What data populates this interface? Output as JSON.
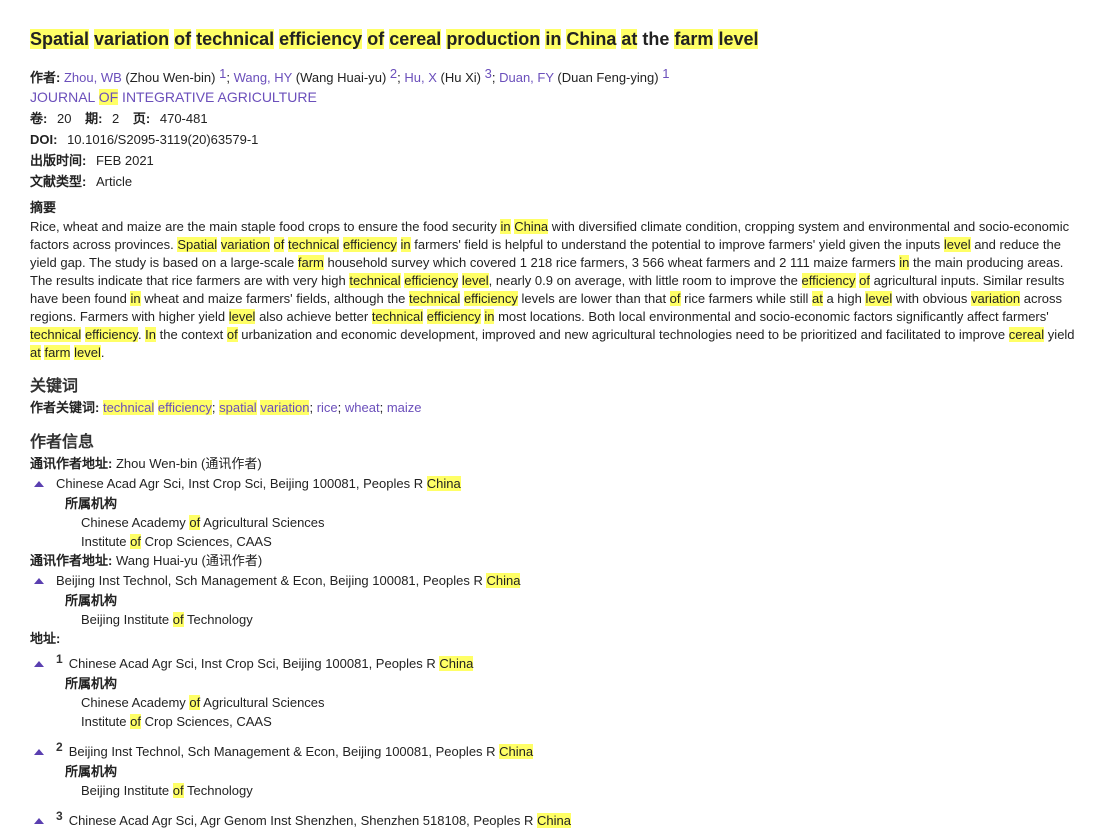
{
  "title": [
    "Spatial",
    "variation",
    "of",
    "technical",
    "efficiency",
    "of",
    "cereal",
    "production",
    "in",
    "China",
    "at",
    "the",
    "farm",
    "level"
  ],
  "title_highlight": [
    true,
    true,
    true,
    true,
    true,
    true,
    true,
    true,
    true,
    true,
    true,
    false,
    true,
    true
  ],
  "labels": {
    "authors": "作者:",
    "volume": "卷:",
    "issue": "期:",
    "pages": "页:",
    "doi": "DOI:",
    "pub_date": "出版时间:",
    "doc_type": "文献类型:",
    "abstract": "摘要",
    "keywords_heading": "关键词",
    "author_keywords": "作者关键词:",
    "author_info": "作者信息",
    "corr_addr": "通讯作者地址:",
    "affil": "所属机构",
    "address": "地址:"
  },
  "authors": [
    {
      "short": "Zhou, WB",
      "full": "(Zhou Wen-bin)",
      "sup": "1"
    },
    {
      "short": "Wang, HY",
      "full": "(Wang Huai-yu)",
      "sup": "2"
    },
    {
      "short": "Hu, X",
      "full": "(Hu Xi)",
      "sup": "3"
    },
    {
      "short": "Duan, FY",
      "full": "(Duan Feng-ying)",
      "sup": "1"
    }
  ],
  "journal": {
    "pre": "JOURNAL ",
    "hl": "OF",
    "post": " INTEGRATIVE AGRICULTURE"
  },
  "volume": "20",
  "issue": "2",
  "pages": "470-481",
  "doi": "10.1016/S2095-3119(20)63579-1",
  "pub_date": "FEB 2021",
  "doc_type": "Article",
  "abstract": [
    {
      "t": "Rice, wheat and maize are the main staple food crops to ensure the food security "
    },
    {
      "t": "in",
      "h": true
    },
    {
      "t": " "
    },
    {
      "t": "China",
      "h": true
    },
    {
      "t": " with diversified climate condition, cropping system and environmental and socio-economic factors across provinces. "
    },
    {
      "t": "Spatial",
      "h": true
    },
    {
      "t": " "
    },
    {
      "t": "variation",
      "h": true
    },
    {
      "t": " "
    },
    {
      "t": "of",
      "h": true
    },
    {
      "t": " "
    },
    {
      "t": "technical",
      "h": true
    },
    {
      "t": " "
    },
    {
      "t": "efficiency",
      "h": true
    },
    {
      "t": " "
    },
    {
      "t": "in",
      "h": true
    },
    {
      "t": " farmers' field is helpful to understand the potential to improve farmers' yield given the inputs "
    },
    {
      "t": "level",
      "h": true
    },
    {
      "t": " and reduce the yield gap. The study is based on a large-scale "
    },
    {
      "t": "farm",
      "h": true
    },
    {
      "t": " household survey which covered 1 218 rice farmers, 3 566 wheat farmers and 2 111 maize farmers "
    },
    {
      "t": "in",
      "h": true
    },
    {
      "t": " the main producing areas. The results indicate that rice farmers are with very high "
    },
    {
      "t": "technical",
      "h": true
    },
    {
      "t": " "
    },
    {
      "t": "efficiency",
      "h": true
    },
    {
      "t": " "
    },
    {
      "t": "level",
      "h": true
    },
    {
      "t": ", nearly 0.9 on average, with little room to improve the "
    },
    {
      "t": "efficiency",
      "h": true
    },
    {
      "t": " "
    },
    {
      "t": "of",
      "h": true
    },
    {
      "t": " agricultural inputs. Similar results have been found "
    },
    {
      "t": "in",
      "h": true
    },
    {
      "t": " wheat and maize farmers' fields, although the "
    },
    {
      "t": "technical",
      "h": true
    },
    {
      "t": " "
    },
    {
      "t": "efficiency",
      "h": true
    },
    {
      "t": " levels are lower than that "
    },
    {
      "t": "of",
      "h": true
    },
    {
      "t": " rice farmers while still "
    },
    {
      "t": "at",
      "h": true
    },
    {
      "t": " a high "
    },
    {
      "t": "level",
      "h": true
    },
    {
      "t": " with obvious "
    },
    {
      "t": "variation",
      "h": true
    },
    {
      "t": " across regions. Farmers with higher yield "
    },
    {
      "t": "level",
      "h": true
    },
    {
      "t": " also achieve better "
    },
    {
      "t": "technical",
      "h": true
    },
    {
      "t": " "
    },
    {
      "t": "efficiency",
      "h": true
    },
    {
      "t": " "
    },
    {
      "t": "in",
      "h": true
    },
    {
      "t": " most locations. Both local environmental and socio-economic factors significantly affect farmers' "
    },
    {
      "t": "technical",
      "h": true
    },
    {
      "t": " "
    },
    {
      "t": "efficiency",
      "h": true
    },
    {
      "t": ". "
    },
    {
      "t": "In",
      "h": true
    },
    {
      "t": " the context "
    },
    {
      "t": "of",
      "h": true
    },
    {
      "t": " urbanization and economic development, improved and new agricultural technologies need to be prioritized and facilitated to improve "
    },
    {
      "t": "cereal",
      "h": true
    },
    {
      "t": " yield "
    },
    {
      "t": "at",
      "h": true
    },
    {
      "t": " "
    },
    {
      "t": "farm",
      "h": true
    },
    {
      "t": " "
    },
    {
      "t": "level",
      "h": true
    },
    {
      "t": "."
    }
  ],
  "keywords": [
    {
      "parts": [
        {
          "t": "technical",
          "h": true
        },
        {
          "t": " "
        },
        {
          "t": "efficiency",
          "h": true
        }
      ]
    },
    {
      "parts": [
        {
          "t": "spatial",
          "h": true
        },
        {
          "t": " "
        },
        {
          "t": "variation",
          "h": true
        }
      ]
    },
    {
      "parts": [
        {
          "t": "rice"
        }
      ]
    },
    {
      "parts": [
        {
          "t": "wheat"
        }
      ]
    },
    {
      "parts": [
        {
          "t": "maize"
        }
      ]
    }
  ],
  "corr_authors": [
    {
      "name": "Zhou Wen-bin",
      "role": "(通讯作者)",
      "addr_pre": "Chinese Acad Agr Sci, Inst Crop Sci, Beijing 100081, Peoples R ",
      "addr_hl": "China",
      "orgs": [
        {
          "pre": "Chinese Academy ",
          "hl": "of",
          "post": " Agricultural Sciences"
        },
        {
          "pre": "Institute ",
          "hl": "of",
          "post": " Crop Sciences, CAAS"
        }
      ]
    },
    {
      "name": "Wang Huai-yu",
      "role": "(通讯作者)",
      "addr_pre": "Beijing Inst Technol, Sch Management & Econ, Beijing 100081, Peoples R ",
      "addr_hl": "China",
      "orgs": [
        {
          "pre": "Beijing Institute ",
          "hl": "of",
          "post": " Technology"
        }
      ]
    }
  ],
  "addresses": [
    {
      "num": "1",
      "addr_pre": "Chinese Acad Agr Sci, Inst Crop Sci, Beijing 100081, Peoples R ",
      "addr_hl": "China",
      "orgs": [
        {
          "pre": "Chinese Academy ",
          "hl": "of",
          "post": " Agricultural Sciences"
        },
        {
          "pre": "Institute ",
          "hl": "of",
          "post": " Crop Sciences, CAAS"
        }
      ]
    },
    {
      "num": "2",
      "addr_pre": "Beijing Inst Technol, Sch Management & Econ, Beijing 100081, Peoples R ",
      "addr_hl": "China",
      "orgs": [
        {
          "pre": "Beijing Institute ",
          "hl": "of",
          "post": " Technology"
        }
      ]
    },
    {
      "num": "3",
      "addr_pre": "Chinese Acad Agr Sci, Agr Genom Inst Shenzhen, Shenzhen 518108, Peoples R ",
      "addr_hl": "China",
      "orgs": []
    }
  ],
  "colors": {
    "highlight": "#ffff66",
    "link": "#6b4fbb",
    "caret": "#5a3fb0"
  }
}
